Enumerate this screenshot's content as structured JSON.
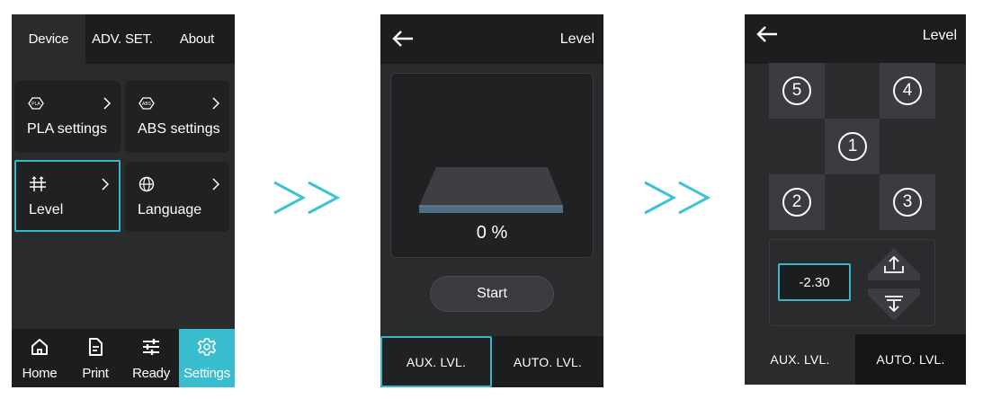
{
  "screen1": {
    "tabs": [
      "Device",
      "ADV. SET.",
      "About"
    ],
    "cards": {
      "pla": {
        "label": "PLA settings",
        "badge": "PLA"
      },
      "abs": {
        "label": "ABS settings",
        "badge": "ABS"
      },
      "level": {
        "label": "Level"
      },
      "language": {
        "label": "Language"
      }
    },
    "nav": [
      "Home",
      "Print",
      "Ready",
      "Settings"
    ],
    "active_nav": "Settings"
  },
  "arrows": ">>",
  "screen2": {
    "title": "Level",
    "progress": "0 %",
    "start": "Start",
    "modes": [
      "AUX. LVL.",
      "AUTO. LVL."
    ],
    "selected_mode": "AUX. LVL."
  },
  "screen3": {
    "title": "Level",
    "points": [
      "5",
      "4",
      "1",
      "2",
      "3"
    ],
    "z_offset": "-2.30",
    "modes": [
      "AUX. LVL.",
      "AUTO. LVL."
    ],
    "selected_mode": "AUTO. LVL."
  },
  "colors": {
    "accent": "#35b8c8",
    "screen_bg": "#2a2b2d",
    "bar_bg": "#1c1d1f"
  }
}
